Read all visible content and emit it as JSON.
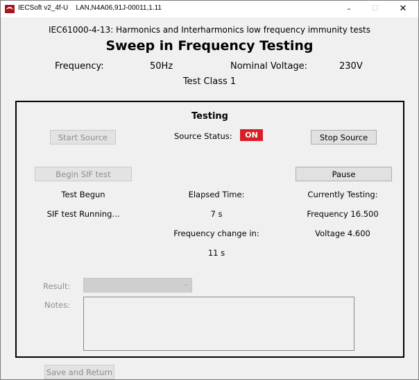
{
  "window": {
    "title": "IECSoft v2_4f-U    LAN,N4A06,91J-00011,1.11",
    "minimize_glyph": "–",
    "maximize_glyph": "☐",
    "close_glyph": "✕"
  },
  "header": {
    "subtitle": "IEC61000-4-13: Harmonics and Interharmonics low frequency immunity tests",
    "title": "Sweep in Frequency Testing",
    "frequency_label": "Frequency:",
    "frequency_value": "50Hz",
    "voltage_label": "Nominal Voltage:",
    "voltage_value": "230V",
    "test_class": "Test Class 1"
  },
  "testing": {
    "heading": "Testing",
    "start_source_label": "Start Source",
    "source_status_label": "Source Status:",
    "source_status_value": "ON",
    "stop_source_label": "Stop Source",
    "begin_sif_label": "Begin SIF test",
    "pause_label": "Pause",
    "test_begun": "Test Begun",
    "sif_status": "SIF test Running...",
    "elapsed_label": "Elapsed Time:",
    "elapsed_value": "7 s",
    "freq_change_label": "Frequency change in:",
    "freq_change_value": "11 s",
    "currently_testing_label": "Currently Testing:",
    "current_frequency": "Frequency 16.500",
    "current_voltage": "Voltage 4.600",
    "result_label": "Result:",
    "result_value": "",
    "notes_label": "Notes:",
    "notes_value": ""
  },
  "footer": {
    "save_return_label": "Save and Return"
  },
  "colors": {
    "status_on": "#d81f26",
    "panel_border": "#000000",
    "window_bg": "#f0f0f0"
  },
  "icons": {
    "app": "iecsoft-logo-icon",
    "dropdown": "chevron-down-icon"
  }
}
